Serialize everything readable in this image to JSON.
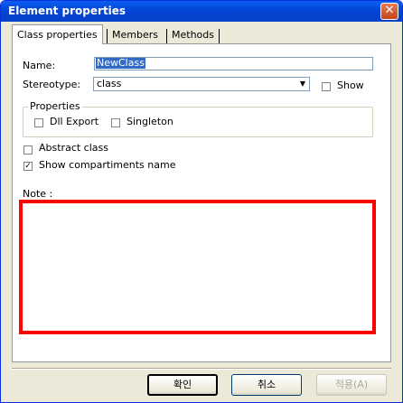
{
  "window": {
    "title": "Element properties"
  },
  "tabs": [
    {
      "label": "Class properties",
      "active": true
    },
    {
      "label": "Members",
      "active": false
    },
    {
      "label": "Methods",
      "active": false
    }
  ],
  "form": {
    "name_label": "Name:",
    "name_value": "NewClass",
    "stereotype_label": "Stereotype:",
    "stereotype_value": "class",
    "show_label": "Show",
    "show_checked": false
  },
  "properties_group": {
    "title": "Properties",
    "dll_export_label": "Dll Export",
    "dll_export_checked": false,
    "singleton_label": "Singleton",
    "singleton_checked": false
  },
  "options": {
    "abstract_label": "Abstract class",
    "abstract_checked": false,
    "show_compartments_label": "Show compartiments name",
    "show_compartments_checked": true
  },
  "note": {
    "label": "Note :",
    "value": ""
  },
  "buttons": {
    "ok": "확인",
    "cancel": "취소",
    "apply": "적용(A)"
  },
  "colors": {
    "note_highlight": "#ff0000",
    "titlebar": "#0346d4"
  }
}
